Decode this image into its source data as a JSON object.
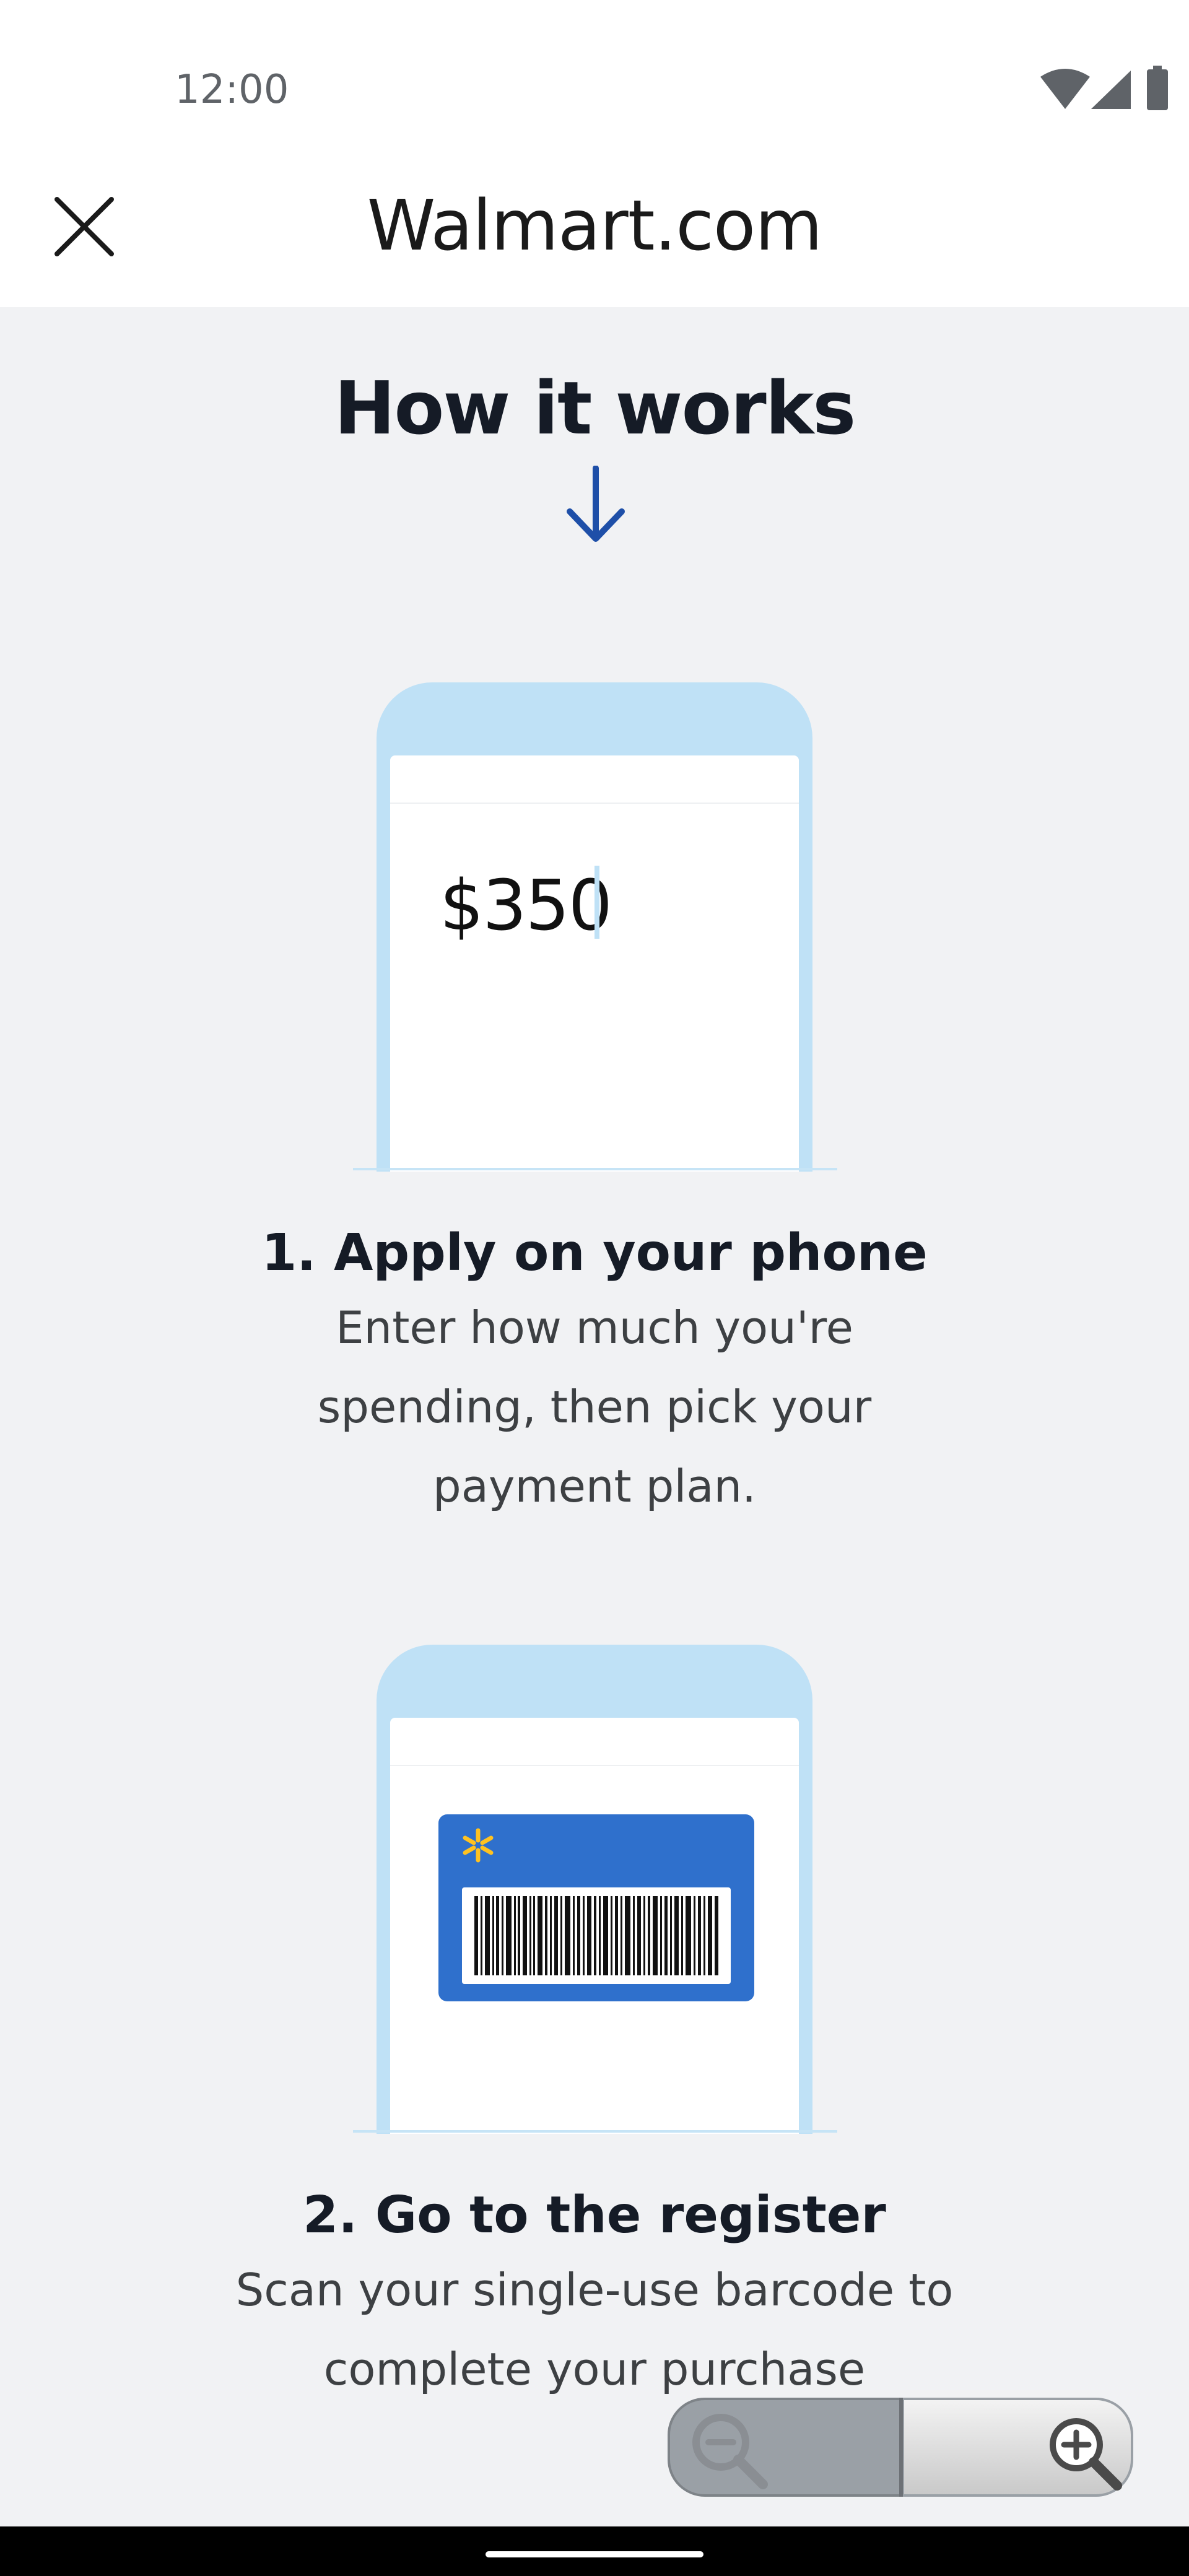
{
  "status_bar": {
    "time": "12:00"
  },
  "app_bar": {
    "title": "Walmart.com",
    "close_icon": "close-icon"
  },
  "content": {
    "heading": "How it works",
    "arrow_icon": "arrow-down-icon",
    "steps": [
      {
        "illustration_amount": "$350",
        "title": "1. Apply on your phone",
        "description": "Enter how much you're spending, then pick your payment plan."
      },
      {
        "title": "2. Go to the register",
        "description": "Scan your single-use barcode to complete your purchase"
      }
    ]
  },
  "zoom_control": {
    "zoom_out_icon": "zoom-out-icon",
    "zoom_in_icon": "zoom-in-icon"
  },
  "colors": {
    "background": "#f1f2f4",
    "phone_frame": "#bfe1f6",
    "card_blue": "#2f70cc",
    "spark_yellow": "#ffc220",
    "arrow_blue": "#1e4fa8"
  }
}
